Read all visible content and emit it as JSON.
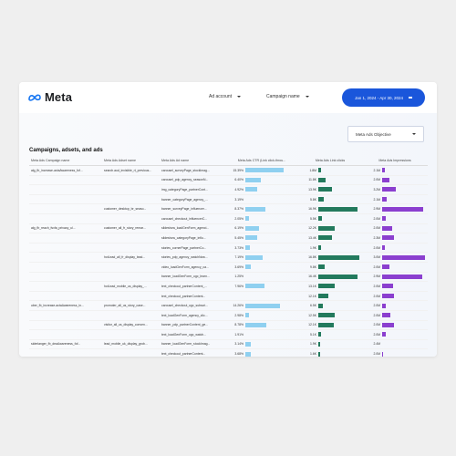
{
  "header": {
    "brand": "Meta",
    "ad_account": "Ad account",
    "campaign_name": "Campaign name",
    "date_range": "Jan 1, 2024 - Apr 30, 2024"
  },
  "filters": {
    "objective": "Meta Ads Objective"
  },
  "colors": {
    "ctr": "#8fd0f0",
    "clicks": "#237a5d",
    "impressions": "#8b3fcf",
    "date_button": "#1a56db"
  },
  "table": {
    "title": "Campaigns, adsets, and ads",
    "columns": [
      "Meta Ads Campaign name",
      "Meta Ads Adset name",
      "Meta Ads Ad name",
      "Meta Ads CTR (Link click-throu...",
      "Meta Ads Link clicks",
      "Meta Ads Impressions"
    ],
    "rows": [
      {
        "campaign": "alg_fb_increase-actaAwareness_fof...",
        "adset": "search.aud_invisible_rt_previous...",
        "ad": "carousel_surveyPage_stockImag...",
        "ctr": "15.39%",
        "ctr_v": 0.83,
        "clicks": "1.8M",
        "clicks_v": 0.05,
        "imp": "2.1M",
        "imp_v": 0.05
      },
      {
        "campaign": "",
        "adset": "",
        "ad": "carousel_pdp_agency_seasonN...",
        "ctr": "6.40%",
        "ctr_v": 0.33,
        "clicks": "11.8K",
        "clicks_v": 0.15,
        "imp": "2.0M",
        "imp_v": 0.16
      },
      {
        "campaign": "",
        "adset": "",
        "ad": "img_categoryPage_partnerCont...",
        "ctr": "4.92%",
        "ctr_v": 0.25,
        "clicks": "13.9K",
        "clicks_v": 0.3,
        "imp": "3.2M",
        "imp_v": 0.3
      },
      {
        "campaign": "",
        "adset": "",
        "ad": "banner_categoryPage_agency_...",
        "ctr": "3.19%",
        "ctr_v": 0.0,
        "clicks": "5.8K",
        "clicks_v": 0.12,
        "imp": "2.1M",
        "imp_v": 0.1
      },
      {
        "campaign": "",
        "adset": "customer_desktop_br_seaso...",
        "ad": "banner_surveyPage_influencer...",
        "ctr": "8.37%",
        "ctr_v": 0.44,
        "clicks": "16.9K",
        "clicks_v": 0.86,
        "imp": "2.9M",
        "imp_v": 0.9
      },
      {
        "campaign": "",
        "adset": "",
        "ad": "carousel_checkout_influencerC...",
        "ctr": "2.05%",
        "ctr_v": 0.07,
        "clicks": "5.5K",
        "clicks_v": 0.08,
        "imp": "2.0M",
        "imp_v": 0.08
      },
      {
        "campaign": "alg_fb_reach_fsxfa_privacy_ul...",
        "adset": "customer_all_fr_story_remar...",
        "ad": "slideshow_loadGenForm_agenci...",
        "ctr": "6.19%",
        "ctr_v": 0.3,
        "clicks": "12.2K",
        "clicks_v": 0.35,
        "imp": "2.0M",
        "imp_v": 0.22
      },
      {
        "campaign": "",
        "adset": "",
        "ad": "slideshow_categoryPage_influ...",
        "ctr": "5.45%",
        "ctr_v": 0.26,
        "clicks": "13.4K",
        "clicks_v": 0.3,
        "imp": "2.3M",
        "imp_v": 0.25
      },
      {
        "campaign": "",
        "adset": "",
        "ad": "stories_cornerPage_partnerCo...",
        "ctr": "3.73%",
        "ctr_v": 0.1,
        "clicks": "1.9K",
        "clicks_v": 0.06,
        "imp": "2.0M",
        "imp_v": 0.05
      },
      {
        "campaign": "",
        "adset": "hotLead_all_fr_display_lead...",
        "ad": "stories_pdp_agency_watchNow...",
        "ctr": "7.19%",
        "ctr_v": 0.37,
        "clicks": "16.8K",
        "clicks_v": 0.9,
        "imp": "3.0M",
        "imp_v": 0.94
      },
      {
        "campaign": "",
        "adset": "",
        "ad": "video_loadGenForm_agency_ca...",
        "ctr": "3.69%",
        "ctr_v": 0.11,
        "clicks": "9.8K",
        "clicks_v": 0.14,
        "imp": "2.0M",
        "imp_v": 0.15
      },
      {
        "campaign": "",
        "adset": "",
        "ad": "banner_loadGenForm_ugc_learn...",
        "ctr": "1.25%",
        "ctr_v": 0.0,
        "clicks": "16.4K",
        "clicks_v": 0.86,
        "imp": "2.9M",
        "imp_v": 0.88
      },
      {
        "campaign": "",
        "adset": "hotLead_mobile_us_display_...",
        "ad": "text_checkout_partnerContent_...",
        "ctr": "7.96%",
        "ctr_v": 0.42,
        "clicks": "13.1K",
        "clicks_v": 0.35,
        "imp": "2.0M",
        "imp_v": 0.24
      },
      {
        "campaign": "",
        "adset": "",
        "ad": "text_checkout_partnerContent...",
        "ctr": "",
        "ctr_v": 0.0,
        "clicks": "12.1K",
        "clicks_v": 0.22,
        "imp": "2.0M",
        "imp_v": 0.25
      },
      {
        "campaign": "uber_fb_increase-actaAwareness_in...",
        "adset": "promoter_all_us_story_case...",
        "ad": "carousel_checkout_ugc_subscri...",
        "ctr": "14.26%",
        "ctr_v": 0.75,
        "clicks": "6.5K",
        "clicks_v": 0.09,
        "imp": "2.0M",
        "imp_v": 0.07
      },
      {
        "campaign": "",
        "adset": "",
        "ad": "text_loadGenForm_agency_clic...",
        "ctr": "2.98%",
        "ctr_v": 0.07,
        "clicks": "12.5K",
        "clicks_v": 0.36,
        "imp": "2.0M",
        "imp_v": 0.18
      },
      {
        "campaign": "",
        "adset": "visitor_all_us_display_conven...",
        "ad": "banner_pdp_partnerContent_ge...",
        "ctr": "8.78%",
        "ctr_v": 0.46,
        "clicks": "12.1K",
        "clicks_v": 0.33,
        "imp": "2.0M",
        "imp_v": 0.25
      },
      {
        "campaign": "",
        "adset": "",
        "ad": "text_loadGenForm_ugc_watch...",
        "ctr": "1.91%",
        "ctr_v": 0.0,
        "clicks": "5.1K",
        "clicks_v": 0.05,
        "imp": "2.0M",
        "imp_v": 0.07
      },
      {
        "campaign": "siderlanger_fb_deaAwareness_fof...",
        "adset": "lead_mobile_uk_display_grob...",
        "ad": "banner_loadGenForm_stockImag...",
        "ctr": "3.14%",
        "ctr_v": 0.12,
        "clicks": "1.9K",
        "clicks_v": 0.04,
        "imp": "2.4M",
        "imp_v": 0.0
      },
      {
        "campaign": "",
        "adset": "",
        "ad": "text_checkout_partnerContent...",
        "ctr": "3.68%",
        "ctr_v": 0.11,
        "clicks": "1.6K",
        "clicks_v": 0.04,
        "imp": "2.0M",
        "imp_v": 0.02
      }
    ]
  }
}
